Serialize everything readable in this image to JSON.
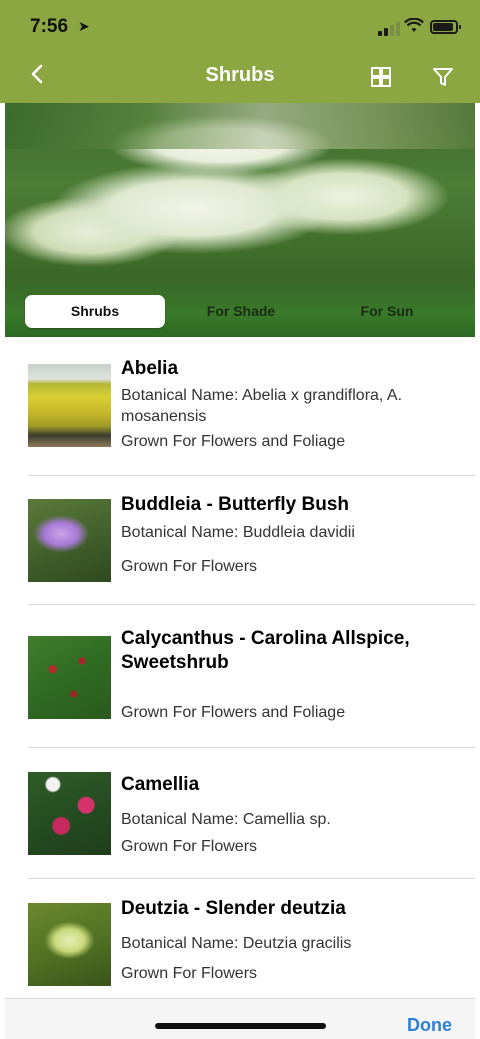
{
  "status_bar": {
    "time": "7:56",
    "location_arrow": "➤"
  },
  "nav": {
    "title": "Shrubs",
    "back_icon": "chevron-left-icon",
    "grid_icon": "grid-icon",
    "filter_icon": "filter-icon"
  },
  "segments": [
    {
      "label": "Shrubs",
      "active": true
    },
    {
      "label": "For Shade",
      "active": false
    },
    {
      "label": "For Sun",
      "active": false
    }
  ],
  "plants": [
    {
      "name": "Abelia",
      "botanical": "Botanical Name: Abelia x grandiflora, A. mosanensis",
      "grown": "Grown For Flowers and Foliage"
    },
    {
      "name": "Buddleia - Butterfly Bush",
      "botanical": "Botanical Name: Buddleia davidii",
      "grown": "Grown For Flowers"
    },
    {
      "name": "Calycanthus - Carolina Allspice, Sweetshrub",
      "botanical": "",
      "grown": "Grown For Flowers and Foliage"
    },
    {
      "name": "Camellia",
      "botanical": "Botanical Name: Camellia sp.",
      "grown": "Grown For Flowers"
    },
    {
      "name": "Deutzia - Slender deutzia",
      "botanical": "Botanical Name: Deutzia gracilis",
      "grown": "Grown For Flowers"
    }
  ],
  "toolbar": {
    "done_label": "Done"
  },
  "colors": {
    "header": "#8ca742",
    "done": "#2f7ed8"
  }
}
